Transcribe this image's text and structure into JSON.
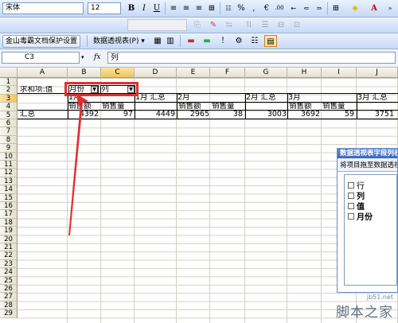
{
  "toolbar1": {
    "font_name": "宋体",
    "font_size": "12",
    "bold": "B",
    "italic": "I",
    "underline": "U",
    "percent": "%",
    "comma": ",",
    "currency": "€",
    "dec_inc": ".00",
    "font_color": "A"
  },
  "toolbar2": {
    "protect": "金山毒霸文档保护设置",
    "pivot_menu": "数据透视表(P) ▾"
  },
  "formula_bar": {
    "name_box": "C3",
    "fx": "fx",
    "value": "列"
  },
  "columns": [
    "A",
    "B",
    "C",
    "D",
    "E",
    "F",
    "G",
    "H",
    "I",
    "J"
  ],
  "rows": [
    "1",
    "2",
    "3",
    "4",
    "5",
    "6",
    "7",
    "8",
    "9",
    "10",
    "11",
    "12",
    "13",
    "14",
    "15",
    "16",
    "17",
    "18",
    "19",
    "20",
    "21",
    "22",
    "23",
    "24",
    "25",
    "26",
    "27",
    "28",
    "29"
  ],
  "pivot": {
    "r3_label": "求和项:值",
    "r3_field1": "月份",
    "r3_field2": "列",
    "r4": {
      "b": "1月",
      "d": "1月 汇总",
      "e": "2月",
      "g": "2月 汇总",
      "h": "3月",
      "j": "3月 汇总"
    },
    "r5": {
      "b": "销售额",
      "c": "销售量",
      "e": "销售额",
      "f": "销售量",
      "h": "销售额",
      "i": "销售量"
    },
    "r6": {
      "a": "汇总",
      "b": "4392",
      "c": "97",
      "d": "4449",
      "e": "2965",
      "f": "38",
      "g": "3003",
      "h": "3692",
      "i": "59",
      "j": "3751"
    }
  },
  "field_panel": {
    "title": "数据透视表字段列表",
    "subtitle": "将项目拖至数据透视表",
    "fields": [
      "行",
      "列",
      "值",
      "月份"
    ]
  },
  "watermark": {
    "site": "jb51.net",
    "brand": "脚本之家"
  },
  "colors": {
    "highlight": "#e03030",
    "accent": "#3b66c0"
  }
}
